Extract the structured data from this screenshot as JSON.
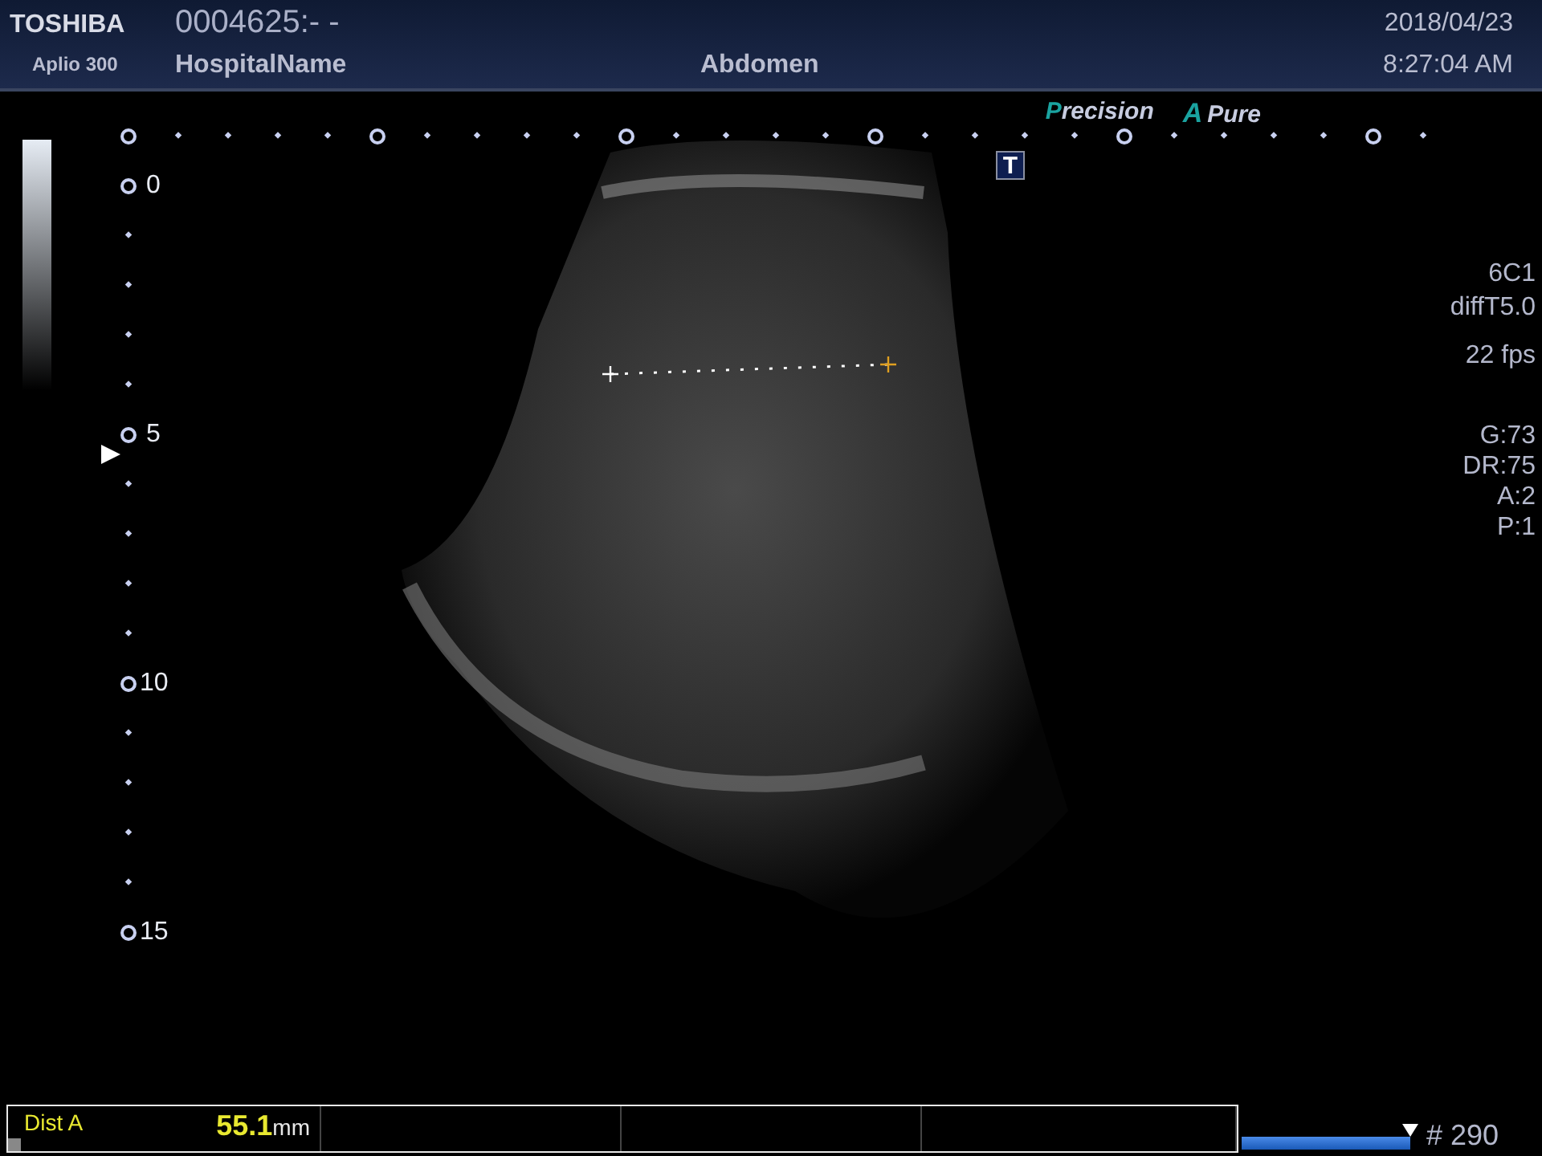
{
  "header": {
    "brand": "TOSHIBA",
    "model": "Aplio 300",
    "patient_id": "0004625:- -",
    "hospital": "HospitalName",
    "exam": "Abdomen",
    "date": "2018/04/23",
    "time": "8:27:04 AM"
  },
  "modes": [
    {
      "label": "Precision"
    },
    {
      "prefix": "A",
      "label": "Pure"
    }
  ],
  "t_badge": "T",
  "depth_labels": [
    "0",
    "5",
    "10",
    "15"
  ],
  "params": [
    [
      "6C1",
      "diffT5.0"
    ],
    [
      "22 fps"
    ],
    [
      "G:73",
      "DR:75",
      "A:2",
      "P:1"
    ]
  ],
  "measurement": {
    "label": "Dist A",
    "value": "55.1",
    "unit": "mm"
  },
  "cine": {
    "level": 1,
    "frame": "# 290"
  }
}
